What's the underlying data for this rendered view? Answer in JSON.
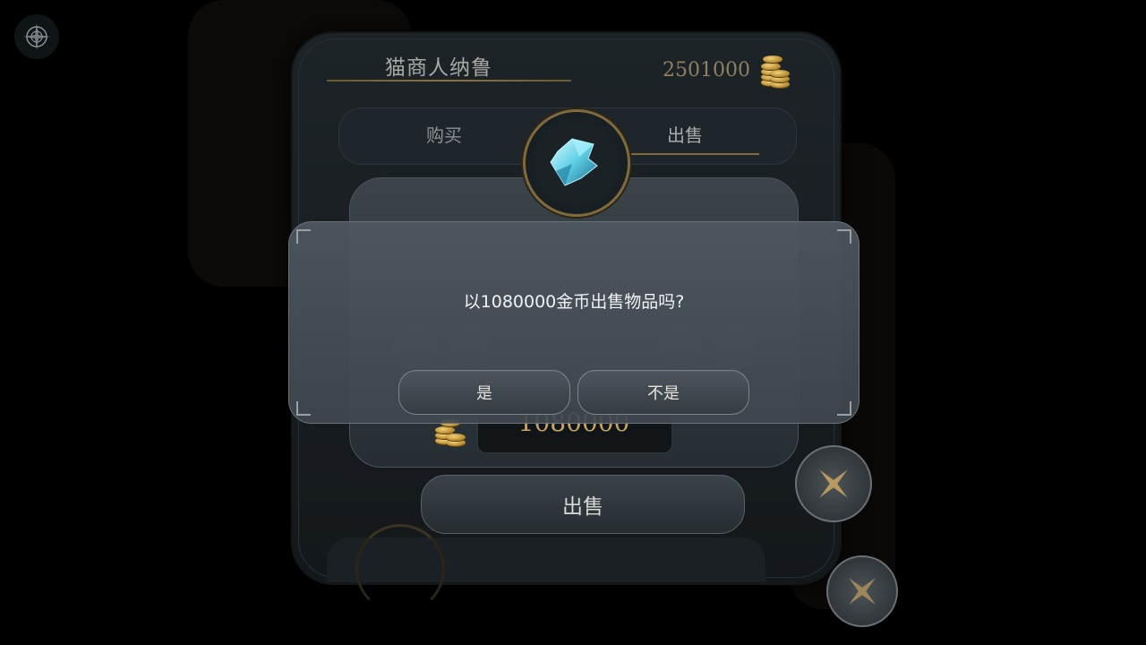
{
  "merchant": {
    "name": "猫商人纳鲁"
  },
  "wallet": {
    "gold": "2501000"
  },
  "tabs": {
    "buy": "购买",
    "sell": "出售",
    "active": "sell"
  },
  "item_card": {
    "price_value": "1080000",
    "sell_button_label": "出售"
  },
  "dialog": {
    "message": "以1080000金币出售物品吗?",
    "yes_label": "是",
    "no_label": "不是"
  },
  "colors": {
    "gold_text": "#c6a766",
    "accent_line": "#7d6b3e",
    "dialog_bg": "#4e5860"
  },
  "icons": [
    "compass-icon",
    "coin-stack-icon",
    "crystal-item-icon",
    "close-x-icon"
  ]
}
